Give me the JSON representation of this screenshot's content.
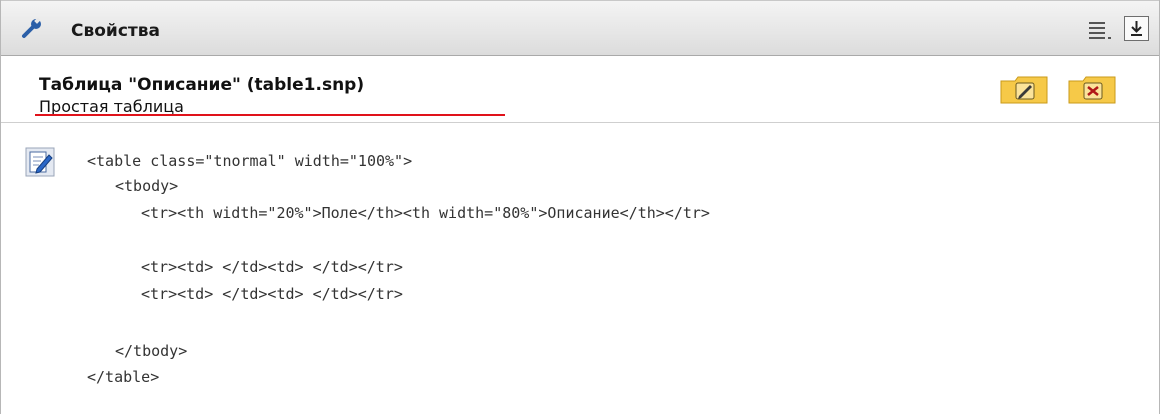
{
  "header": {
    "title": "Свойства",
    "icons": {
      "tool": "wrench-icon",
      "menu": "list-menu-icon",
      "download": "download-arrow-icon"
    }
  },
  "properties": {
    "title": "Таблица \"Описание\" (table1.snp)",
    "subtitle": "Простая таблица",
    "underline_color": "#e0121a",
    "actions": {
      "edit": "pencil-icon",
      "close": "close-x-icon"
    }
  },
  "code": {
    "edit_icon": "edit-document-icon",
    "lines": [
      "<table class=\"tnormal\" width=\"100%\">",
      "<tbody>",
      "<tr><th width=\"20%\">Поле</th><th width=\"80%\">Описание</th></tr>",
      "<tr><td> </td><td> </td></tr>",
      "<tr><td> </td><td> </td></tr>",
      "</tbody>",
      "</table>"
    ]
  },
  "colors": {
    "header_bg": "#dcdcdc",
    "folder": "#f4c542",
    "accent_line": "#e0121a"
  }
}
